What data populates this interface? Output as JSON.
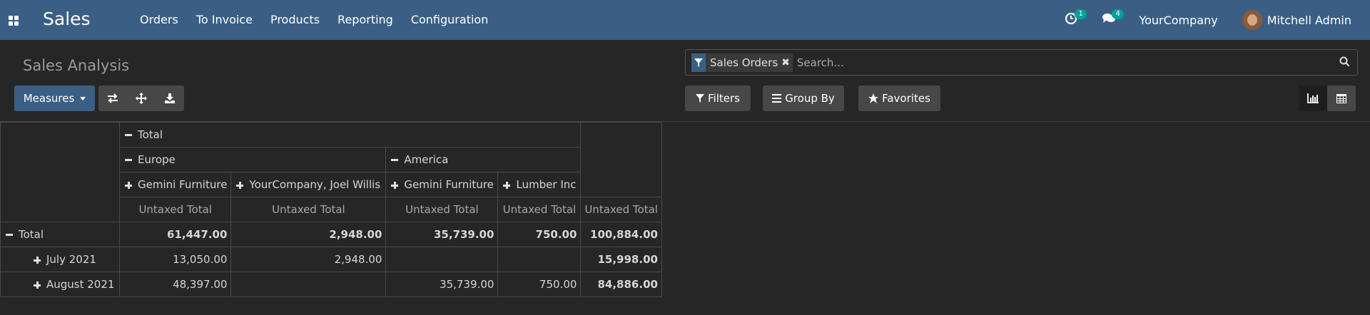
{
  "navbar": {
    "app_title": "Sales",
    "menu": [
      "Orders",
      "To Invoice",
      "Products",
      "Reporting",
      "Configuration"
    ],
    "activity_badge": "1",
    "messages_badge": "4",
    "company": "YourCompany",
    "user": "Mitchell Admin",
    "color": "#3b5f84"
  },
  "control_panel": {
    "breadcrumb": "Sales Analysis",
    "search": {
      "facet": "Sales Orders",
      "placeholder": "Search..."
    },
    "measures_label": "Measures",
    "filters_label": "Filters",
    "groupby_label": "Group By",
    "favorites_label": "Favorites"
  },
  "pivot": {
    "top_header": "Total",
    "groups": [
      {
        "name": "Europe",
        "cols": [
          "Gemini Furniture",
          "YourCompany, Joel Willis"
        ]
      },
      {
        "name": "America",
        "cols": [
          "Gemini Furniture",
          "Lumber Inc"
        ]
      }
    ],
    "measure": "Untaxed Total",
    "rows": [
      {
        "label": "Total",
        "values": [
          "61,447.00",
          "2,948.00",
          "35,739.00",
          "750.00"
        ],
        "total": "100,884.00"
      },
      {
        "label": "July 2021",
        "values": [
          "13,050.00",
          "2,948.00",
          "",
          ""
        ],
        "total": "15,998.00"
      },
      {
        "label": "August 2021",
        "values": [
          "48,397.00",
          "",
          "35,739.00",
          "750.00"
        ],
        "total": "84,886.00"
      }
    ]
  }
}
